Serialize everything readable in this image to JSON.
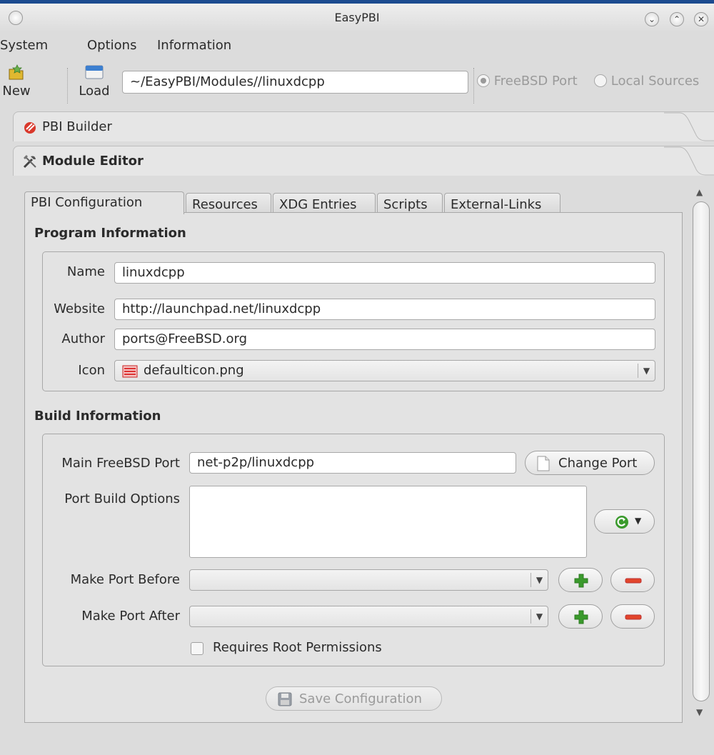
{
  "window": {
    "title": "EasyPBI"
  },
  "menu": [
    "System",
    "Options",
    "Information"
  ],
  "toolbar": {
    "new_label": "New",
    "load_label": "Load",
    "path": "~/EasyPBI/Modules//linuxdcpp",
    "radio_port": "FreeBSD Port",
    "radio_local": "Local Sources"
  },
  "toolbox": {
    "pbi_builder": "PBI Builder",
    "module_editor": "Module Editor"
  },
  "tabs": [
    "PBI Configuration",
    "Resources",
    "XDG Entries",
    "Scripts",
    "External-Links"
  ],
  "program_info": {
    "title": "Program Information",
    "name_label": "Name",
    "name_value": "linuxdcpp",
    "website_label": "Website",
    "website_value": "http://launchpad.net/linuxdcpp",
    "author_label": "Author",
    "author_value": "ports@FreeBSD.org",
    "icon_label": "Icon",
    "icon_value": "defaulticon.png"
  },
  "build_info": {
    "title": "Build Information",
    "main_port_label": "Main FreeBSD Port",
    "main_port_value": "net-p2p/linuxdcpp",
    "change_port": "Change Port",
    "options_label": "Port Build Options",
    "options_value": "",
    "make_before_label": "Make Port Before",
    "make_before_value": "",
    "make_after_label": "Make Port After",
    "make_after_value": "",
    "requires_root": "Requires Root Permissions",
    "requires_root_checked": false
  },
  "save_button": "Save Configuration",
  "colors": {
    "accent_green": "#3a9a2c",
    "remove_red": "#e2452b",
    "title_strip": "#1c4b8f"
  }
}
